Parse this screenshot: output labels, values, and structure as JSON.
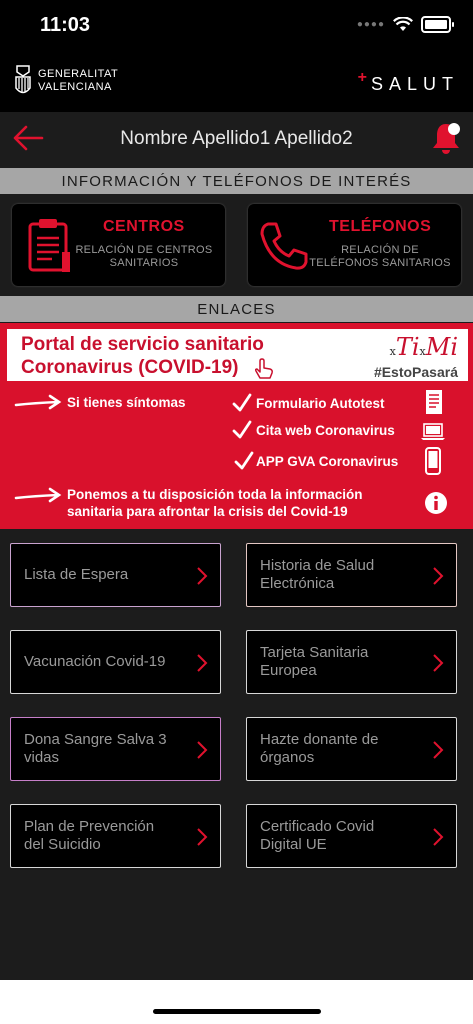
{
  "status_bar": {
    "time": "11:03"
  },
  "brand": {
    "gva_line1": "GENERALITAT",
    "gva_line2": "VALENCIANA",
    "salut_plus": "+",
    "salut": "SALUT"
  },
  "header": {
    "user_name": "Nombre Apellido1 Apellido2"
  },
  "info_section": {
    "title": "INFORMACIÓN Y TELÉFONOS DE INTERÉS",
    "centros": {
      "title": "CENTROS",
      "subtitle_line1": "RELACIÓN DE CENTROS",
      "subtitle_line2": "SANITARIOS"
    },
    "telefonos": {
      "title": "TELÉFONOS",
      "subtitle_line1": "RELACIÓN DE",
      "subtitle_line2": "TELÉFONOS SANITARIOS"
    }
  },
  "links_section": {
    "title": "ENLACES"
  },
  "covid": {
    "portal_line1": "Portal de servicio sanitario",
    "portal_line2": "Coronavirus (COVID-19)",
    "logo_ti": "Ti",
    "logo_mi": "Mi",
    "logo_x": "x",
    "hashtag": "#EstoPasará",
    "symptoms": "Si tienes síntomas",
    "link_autotest": "Formulario Autotest",
    "link_cita": "Cita web Coronavirus",
    "link_app": "APP GVA Coronavirus",
    "info_line1": "Ponemos a tu disposición toda la información",
    "info_line2": "sanitaria para afrontar la crisis del Covid-19"
  },
  "tiles": [
    {
      "label": "Lista de Espera",
      "border": "#c9a3cf"
    },
    {
      "label": "Historia de Salud Electrónica",
      "border": "#e3c7c3"
    },
    {
      "label": "Vacunación Covid-19",
      "border": "#d7d7d7"
    },
    {
      "label": "Tarjeta Sanitaria Europea",
      "border": "#d7d7d7"
    },
    {
      "label": "Dona Sangre Salva 3 vidas",
      "border": "#c67fc9"
    },
    {
      "label": "Hazte donante de órganos",
      "border": "#d7d7d7"
    },
    {
      "label": "Plan de Prevención del Suicidio",
      "border": "#d7d7d7"
    },
    {
      "label": "Certificado Covid Digital UE",
      "border": "#d7d7d7"
    }
  ],
  "colors": {
    "accent_red": "#e0122e",
    "banner_red": "#d9112c",
    "section_gray": "#a6a6a6"
  },
  "icons": [
    "back-arrow-icon",
    "notification-bell-icon",
    "clipboard-icon",
    "phone-icon",
    "chevron-right-icon",
    "info-icon"
  ]
}
